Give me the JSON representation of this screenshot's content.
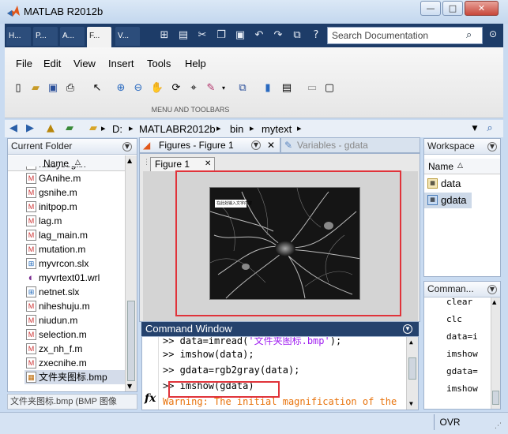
{
  "window": {
    "title": "MATLAB R2012b"
  },
  "tabs": [
    "H...",
    "P...",
    "A...",
    "F...",
    "V..."
  ],
  "search": {
    "placeholder": "Search Documentation"
  },
  "menus": [
    "File",
    "Edit",
    "View",
    "Insert",
    "Tools",
    "Help"
  ],
  "toolstrip": {
    "section_label": "MENU AND TOOLBARS"
  },
  "address": {
    "drive": "D:",
    "crumbs": [
      "MATLABR2012b",
      "bin",
      "mytext"
    ]
  },
  "current_folder": {
    "title": "Current Folder",
    "column_header": "Name",
    "items": [
      {
        "name": "fuzzysegfix",
        "type": "m"
      },
      {
        "name": "GAnihe.m",
        "type": "m"
      },
      {
        "name": "gsnihe.m",
        "type": "m"
      },
      {
        "name": "initpop.m",
        "type": "m"
      },
      {
        "name": "lag.m",
        "type": "m"
      },
      {
        "name": "lag_main.m",
        "type": "m"
      },
      {
        "name": "mutation.m",
        "type": "m"
      },
      {
        "name": "myvrcon.slx",
        "type": "slx"
      },
      {
        "name": "myvrtext01.wrl",
        "type": "wrl"
      },
      {
        "name": "netnet.slx",
        "type": "slx"
      },
      {
        "name": "niheshuju.m",
        "type": "m"
      },
      {
        "name": "niudun.m",
        "type": "m"
      },
      {
        "name": "selection.m",
        "type": "m"
      },
      {
        "name": "zx_nh_f.m",
        "type": "m"
      },
      {
        "name": "zxecnihe.m",
        "type": "m"
      },
      {
        "name": "文件夹图标.bmp",
        "type": "bmp"
      }
    ],
    "details": "文件夹图标.bmp (BMP 图像"
  },
  "figures": {
    "tab_title": "Figures - Figure 1",
    "variables_title": "Variables - gdata",
    "doc_tab": "Figure 1",
    "image_text": "在此处输入文字内容"
  },
  "workspace": {
    "title": "Workspace",
    "column_header": "Name",
    "vars": [
      "data",
      "gdata"
    ]
  },
  "command_history": {
    "title": "Comman...",
    "items": [
      "clear",
      "clc",
      "data=i",
      "imshow",
      "gdata=",
      "imshow"
    ]
  },
  "command_window": {
    "title": "Command Window",
    "lines": [
      ">> data=imread('文件夹图标.bmp');",
      ">> imshow(data);",
      ">> gdata=rgb2gray(data);",
      ">> imshow(gdata)"
    ],
    "line1_prefix": ">> data=imread(",
    "line1_string": "'文件夹图标.bmp'",
    "line1_suffix": ");",
    "warning": "Warning: The initial magnification of the"
  },
  "status": {
    "ovr": "OVR"
  },
  "colors": {
    "accent": "#25426d",
    "highlight": "#e0333a",
    "warning": "#e8730c"
  }
}
